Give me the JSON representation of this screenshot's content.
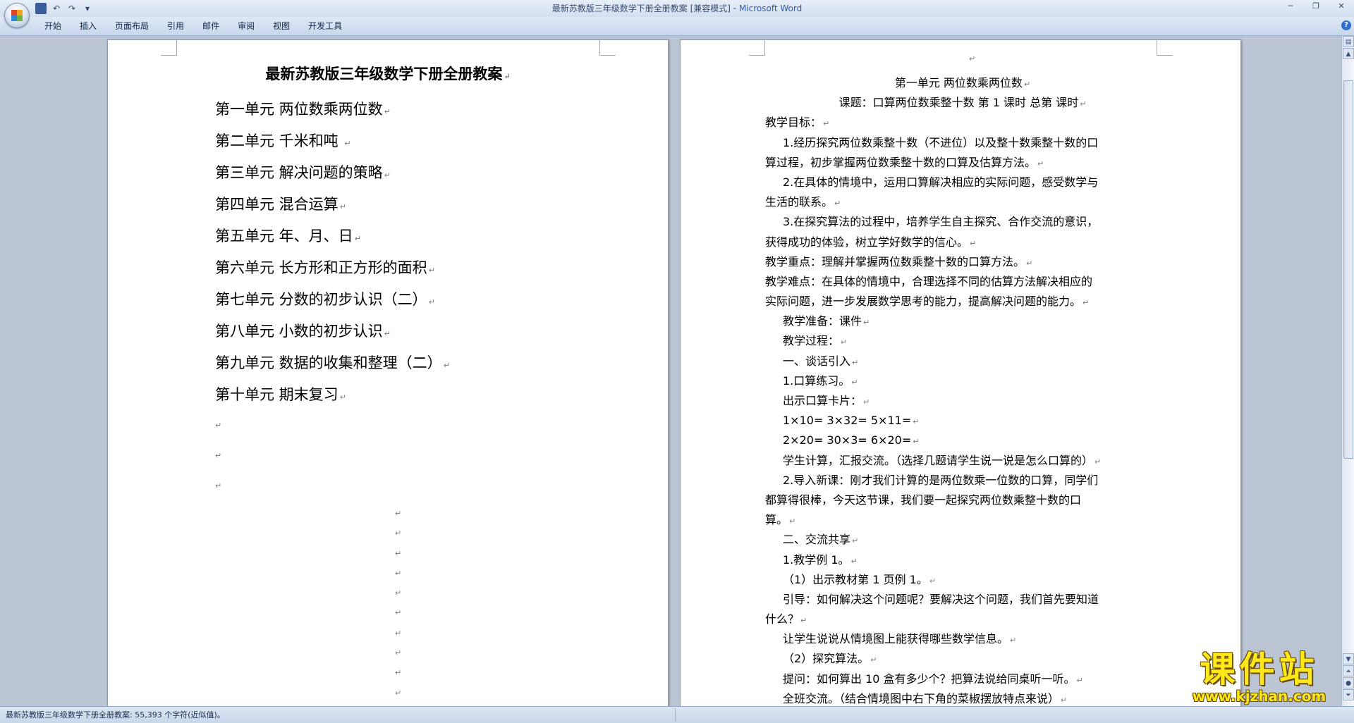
{
  "window": {
    "title_doc": "最新苏教版三年级数学下册全册教案 [兼容模式]",
    "title_sep": " - ",
    "title_app": "Microsoft Word"
  },
  "ribbon": {
    "tabs": [
      "开始",
      "插入",
      "页面布局",
      "引用",
      "邮件",
      "审阅",
      "视图",
      "开发工具"
    ]
  },
  "left_page": {
    "title": "最新苏教版三年级数学下册全册教案",
    "toc": [
      "第一单元  两位数乘两位数",
      "第二单元  千米和吨 ",
      "第三单元  解决问题的策略",
      "第四单元  混合运算",
      "第五单元  年、月、日",
      "第六单元  长方形和正方形的面积",
      "第七单元  分数的初步认识（二）",
      "第八单元  小数的初步认识",
      "第九单元  数据的收集和整理（二）",
      "第十单元  期末复习"
    ],
    "paragraph_mark": "↵"
  },
  "right_page": {
    "lines": [
      "第一单元  两位数乘两位数",
      "课题：口算两位数乘整十数  第 1 课时  总第  课时",
      "教学目标：",
      "1.经历探究两位数乘整十数（不进位）以及整十数乘整十数的口",
      "算过程，初步掌握两位数乘整十数的口算及估算方法。",
      "2.在具体的情境中，运用口算解决相应的实际问题，感受数学与",
      "生活的联系。",
      "3.在探究算法的过程中，培养学生自主探究、合作交流的意识，",
      "获得成功的体验，树立学好数学的信心。",
      "教学重点：理解并掌握两位数乘整十数的口算方法。",
      "教学难点：在具体的情境中，合理选择不同的估算方法解决相应的",
      "实际问题，进一步发展数学思考的能力，提高解决问题的能力。",
      "教学准备：课件",
      "教学过程：",
      "一、谈话引入",
      "1.口算练习。",
      "出示口算卡片：",
      "1×10= 3×32= 5×11=",
      "2×20= 30×3= 6×20=",
      "学生计算，汇报交流。（选择几题请学生说一说是怎么口算的）",
      "2.导入新课：刚才我们计算的是两位数乘一位数的口算，同学们",
      "都算得很棒，今天这节课，我们要一起探究两位数乘整十数的口",
      "算。",
      "二、交流共享",
      "1.教学例 1。",
      "（1）出示教材第 1 页例 1。",
      "引导：如何解决这个问题呢？要解决这个问题，我们首先要知道",
      "什么？",
      "让学生说说从情境图上能获得哪些数学信息。",
      "（2）探究算法。",
      "提问：如何算出 10 盒有多少个？把算法说给同桌听一听。",
      "全班交流。（结合情境图中右下角的菜椒摆放特点来说）"
    ]
  },
  "status": {
    "text": "最新苏教版三年级数学下册全册教案: 55,393 个字符(近似值)。"
  },
  "watermark": {
    "cn": "课件站",
    "url": "www.kjzhan.com"
  }
}
